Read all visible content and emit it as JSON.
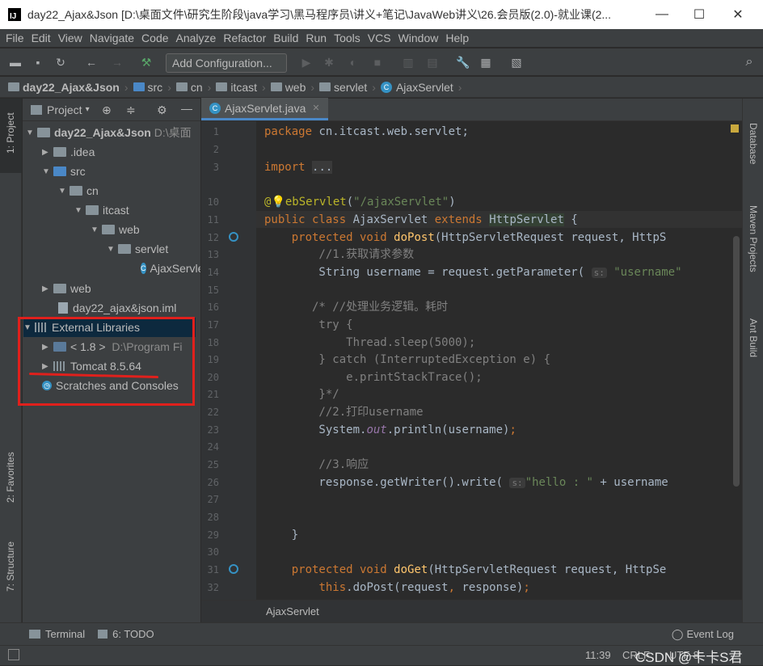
{
  "window": {
    "title": "day22_Ajax&Json [D:\\桌面文件\\研究生阶段\\java学习\\黑马程序员\\讲义+笔记\\JavaWeb讲义\\26.会员版(2.0)-就业课(2...",
    "minimize": "—",
    "maximize": "☐",
    "close": "✕"
  },
  "menu": [
    "File",
    "Edit",
    "View",
    "Navigate",
    "Code",
    "Analyze",
    "Refactor",
    "Build",
    "Run",
    "Tools",
    "VCS",
    "Window",
    "Help"
  ],
  "toolbar": {
    "add_configuration": "Add Configuration..."
  },
  "breadcrumbs": [
    "day22_Ajax&Json",
    "src",
    "cn",
    "itcast",
    "web",
    "servlet",
    "AjaxServlet"
  ],
  "left_tools": {
    "project": "1: Project",
    "favorites": "2: Favorites",
    "structure": "7: Structure"
  },
  "right_tools": {
    "database": "Database",
    "maven": "Maven Projects",
    "ant": "Ant Build"
  },
  "project_panel": {
    "header": "Project",
    "tree": [
      {
        "label": "day22_Ajax&Json",
        "extra": "D:\\桌面"
      },
      {
        "label": ".idea"
      },
      {
        "label": "src"
      },
      {
        "label": "cn"
      },
      {
        "label": "itcast"
      },
      {
        "label": "web"
      },
      {
        "label": "servlet"
      },
      {
        "label": "AjaxServlet"
      },
      {
        "label": "web"
      },
      {
        "label": "day22_ajax&json.iml"
      },
      {
        "label": "External Libraries"
      },
      {
        "label": "< 1.8 >",
        "extra": "D:\\Program Fi"
      },
      {
        "label": "Tomcat 8.5.64"
      },
      {
        "label": "Scratches and Consoles"
      }
    ]
  },
  "editor": {
    "tab": "AjaxServlet.java",
    "footer": "AjaxServlet",
    "line_numbers": [
      "1",
      "2",
      "3",
      "10",
      "11",
      "12",
      "13",
      "14",
      "15",
      "16",
      "17",
      "18",
      "19",
      "20",
      "21",
      "22",
      "23",
      "24",
      "25",
      "26",
      "27",
      "28",
      "29",
      "30",
      "31",
      "32"
    ]
  },
  "bottom_tools": {
    "terminal": "Terminal",
    "todo": "6: TODO",
    "event_log": "Event Log"
  },
  "status": {
    "position": "11:39",
    "line_sep": "CRLF",
    "encoding": "UTF-8",
    "watermark": "CSDN @卡卡S君"
  }
}
